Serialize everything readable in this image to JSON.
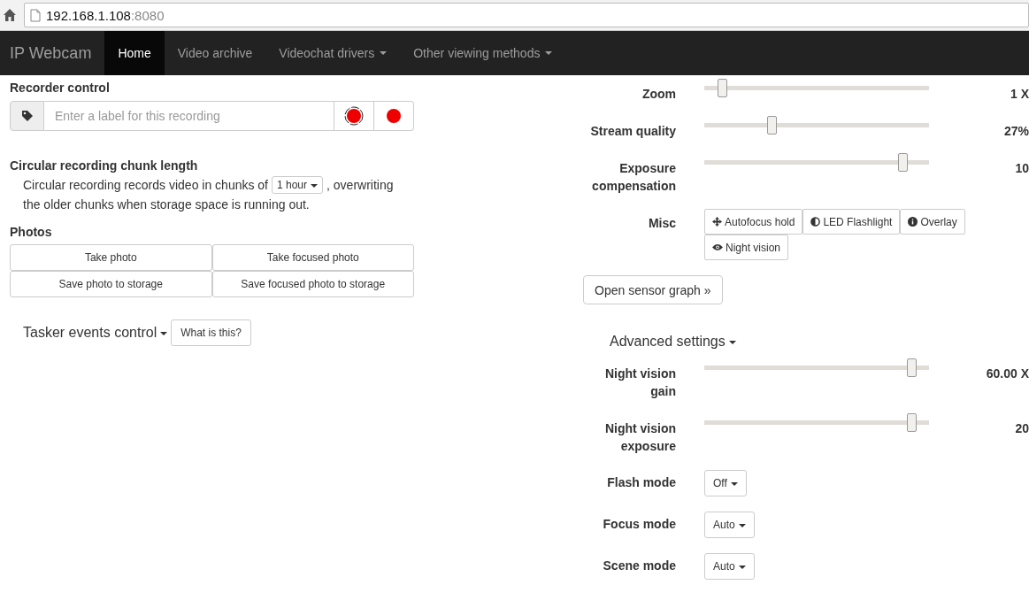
{
  "address_bar": {
    "host": "192.168.1.108",
    "port": ":8080"
  },
  "navbar": {
    "brand": "IP Webcam",
    "items": [
      {
        "label": "Home",
        "selected": true,
        "dropdown": false
      },
      {
        "label": "Video archive",
        "selected": false,
        "dropdown": false
      },
      {
        "label": "Videochat drivers",
        "selected": false,
        "dropdown": true
      },
      {
        "label": "Other viewing methods",
        "selected": false,
        "dropdown": true
      }
    ]
  },
  "recorder": {
    "title": "Recorder control",
    "placeholder": "Enter a label for this recording"
  },
  "chunk": {
    "title": "Circular recording chunk length",
    "text_before": "Circular recording records video in chunks of",
    "select": "1 hour",
    "text_after": ", overwriting",
    "text_line2": "the older chunks when storage space is running out."
  },
  "photos": {
    "title": "Photos",
    "buttons": [
      "Take photo",
      "Take focused photo",
      "Save photo to storage",
      "Save focused photo to storage"
    ]
  },
  "tasker": {
    "label": "Tasker events control",
    "help": "What is this?"
  },
  "sliders": [
    {
      "label": "Zoom",
      "level": 0.08,
      "reading": "1 X"
    },
    {
      "label": "Stream quality",
      "level": 0.3,
      "reading": "27%"
    },
    {
      "label": "Exposure compensation",
      "level": 0.88,
      "reading": "10"
    }
  ],
  "misc": {
    "label": "Misc",
    "buttons": [
      "Autofocus hold",
      "LED Flashlight",
      "Overlay",
      "Night vision"
    ]
  },
  "sensor_button": "Open sensor graph »",
  "advanced": {
    "title": "Advanced settings",
    "sliders": [
      {
        "label": "Night vision gain",
        "level": 0.92,
        "reading": "60.00 X"
      },
      {
        "label": "Night vision exposure",
        "level": 0.92,
        "reading": "20"
      }
    ],
    "selects": [
      {
        "label": "Flash mode",
        "value": "Off"
      },
      {
        "label": "Focus mode",
        "value": "Auto"
      },
      {
        "label": "Scene mode",
        "value": "Auto"
      }
    ]
  }
}
